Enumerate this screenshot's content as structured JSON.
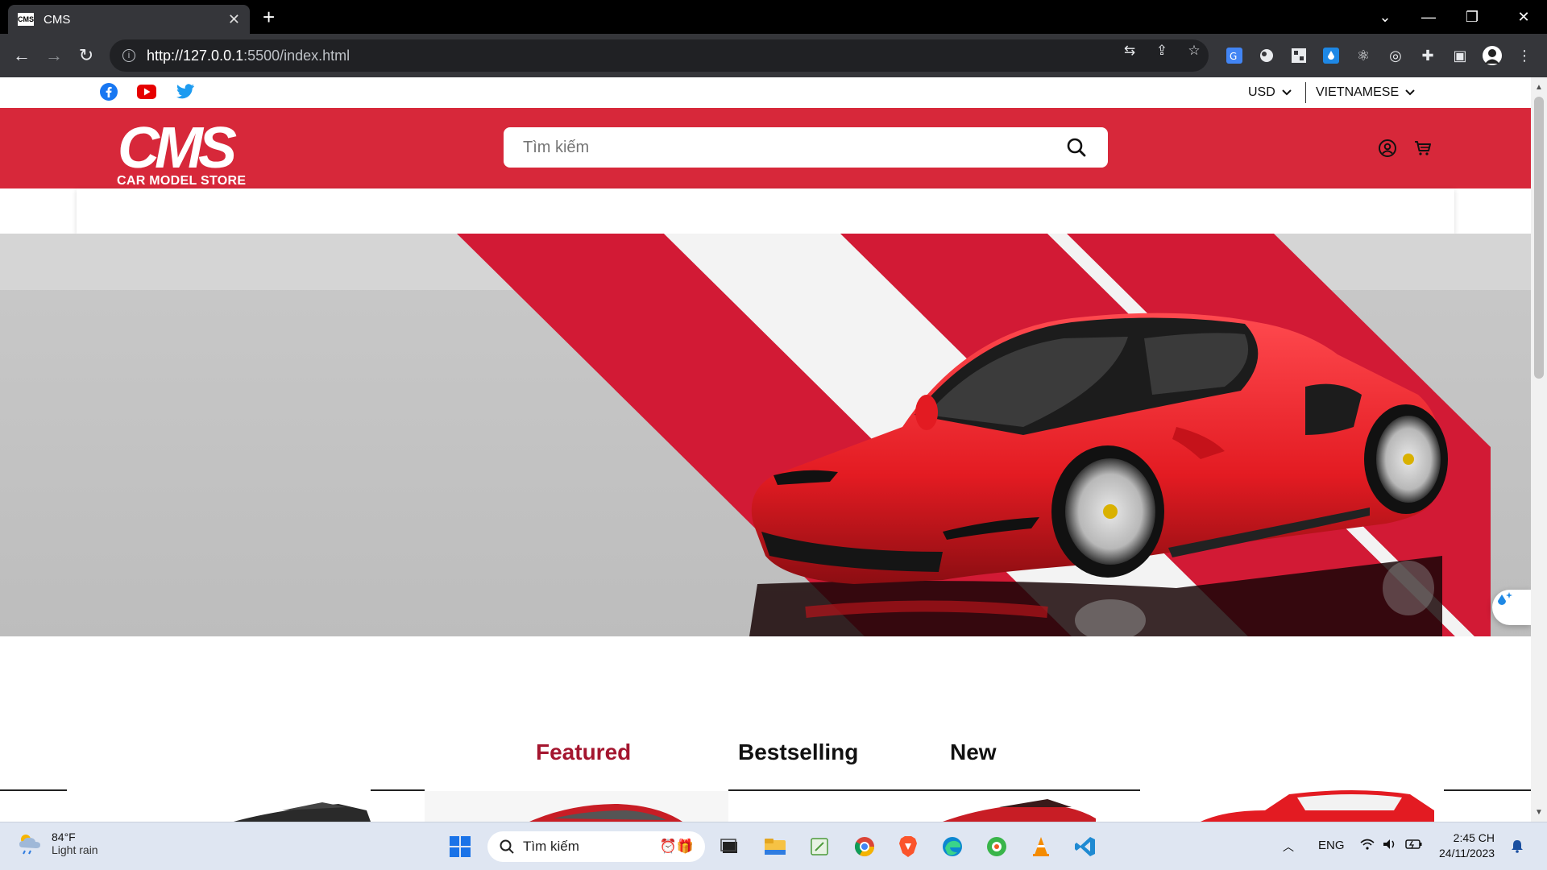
{
  "browser": {
    "tab_title": "CMS",
    "favicon_text": "CMS",
    "url_host": "http://127.0.0.1",
    "url_path": ":5500/index.html"
  },
  "topbar": {
    "currency": "USD",
    "language": "VIETNAMESE"
  },
  "header": {
    "logo_text": "CMS",
    "logo_subtitle": "CAR MODEL STORE",
    "search_placeholder": "Tìm kiếm"
  },
  "product_tabs": [
    {
      "label": "Featured",
      "active": true
    },
    {
      "label": "Bestselling",
      "active": false
    },
    {
      "label": "New",
      "active": false
    }
  ],
  "colors": {
    "brand_red": "#d7283a",
    "active_tab": "#a4162f"
  },
  "taskbar": {
    "weather_temp": "84°F",
    "weather_condition": "Light rain",
    "search_placeholder": "Tìm kiếm",
    "language": "ENG",
    "time": "2:45 CH",
    "date": "24/11/2023"
  }
}
